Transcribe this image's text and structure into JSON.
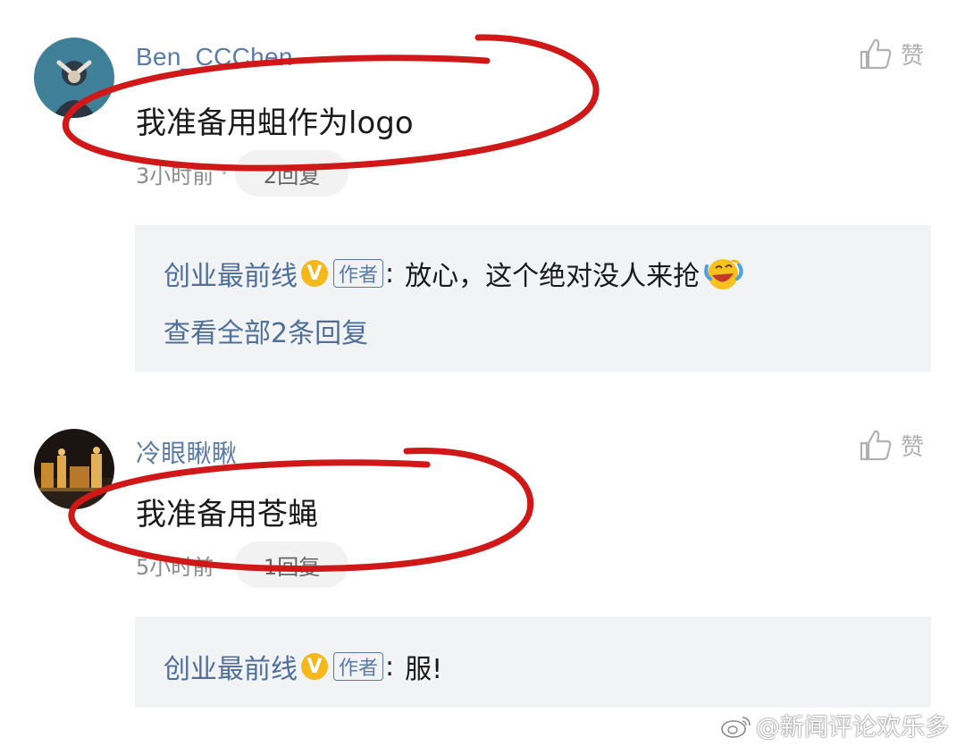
{
  "comments": [
    {
      "username": "Ben_CCChen",
      "text": "我准备用蛆作为logo",
      "time": "3小时前",
      "separator": "·",
      "reply_count": "2回复",
      "like_label": "赞",
      "replies": [
        {
          "author": "创业最前线",
          "verified_badge": "V",
          "author_tag": "作者",
          "colon": ":",
          "text": "放心，这个绝对没人来抢",
          "emoji": "laughing-crying-emoji"
        }
      ],
      "view_all": "查看全部2条回复"
    },
    {
      "username": "冷眼瞅瞅",
      "text": "我准备用苍蝇",
      "time": "5小时前",
      "separator": "·",
      "reply_count": "1回复",
      "like_label": "赞",
      "replies": [
        {
          "author": "创业最前线",
          "verified_badge": "V",
          "author_tag": "作者",
          "colon": ":",
          "text": "服!"
        }
      ]
    }
  ],
  "watermark": "@新闻评论欢乐多",
  "colors": {
    "username": "#5a7ba8",
    "reply_author": "#4e6f9c",
    "verified_badge": "#f5b81b",
    "reply_bg": "#f1f3f5",
    "annotation": "#d01818"
  },
  "icons": [
    "thumbs-up-icon",
    "verified-badge-icon",
    "weibo-logo-icon"
  ]
}
